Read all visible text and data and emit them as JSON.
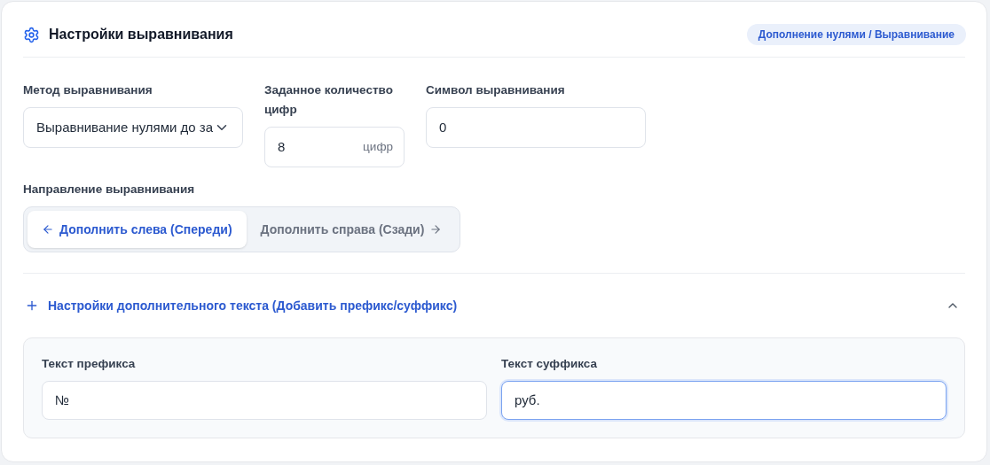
{
  "header": {
    "title": "Настройки выравнивания",
    "badge": "Дополнение нулями / Выравнивание"
  },
  "fields": [
    {
      "kind": "select",
      "label": "Метод выравнивания",
      "value": "Выравнивание нулями до за"
    },
    {
      "kind": "number",
      "label": "Заданное количество цифр",
      "value": "8",
      "unit": "цифр"
    },
    {
      "kind": "text",
      "label": "Символ выравнивания",
      "value": "0"
    }
  ],
  "direction": {
    "label": "Направление выравнивания",
    "options": [
      {
        "label": "Дополнить слева (Спереди)",
        "kind": "back",
        "selected": true
      },
      {
        "label": "Дополнить справа (Сзади)",
        "kind": "forward",
        "selected": false
      }
    ]
  },
  "extra": {
    "title": "Настройки дополнительного текста (Добавить префикс/суффикс)",
    "expanded": true,
    "fields": [
      {
        "label": "Текст префикса",
        "value": "№",
        "focused": false
      },
      {
        "label": "Текст суффикса",
        "value": "руб.",
        "focused": true
      }
    ]
  }
}
